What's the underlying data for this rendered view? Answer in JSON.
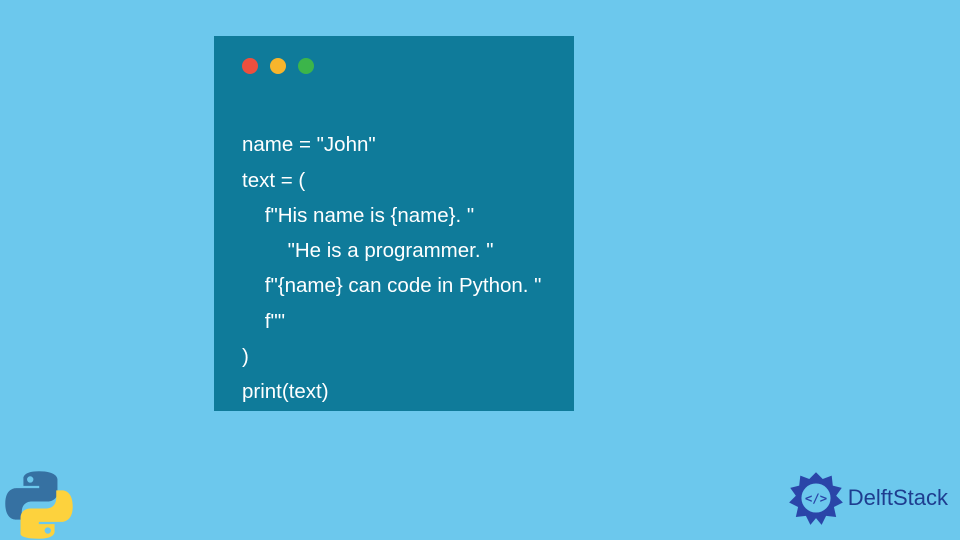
{
  "code": {
    "lines": [
      "name = \"John\"",
      "text = (",
      "    f\"His name is {name}. \"",
      "        \"He is a programmer. \"",
      "    f\"{name} can code in Python. \"",
      "    f\"\"",
      ")",
      "print(text)"
    ]
  },
  "brand": {
    "name": "DelftStack"
  },
  "colors": {
    "background": "#6cc8ed",
    "codeBackground": "#0f7b9a",
    "codeText": "#ffffff",
    "brandText": "#1e3d8f"
  }
}
